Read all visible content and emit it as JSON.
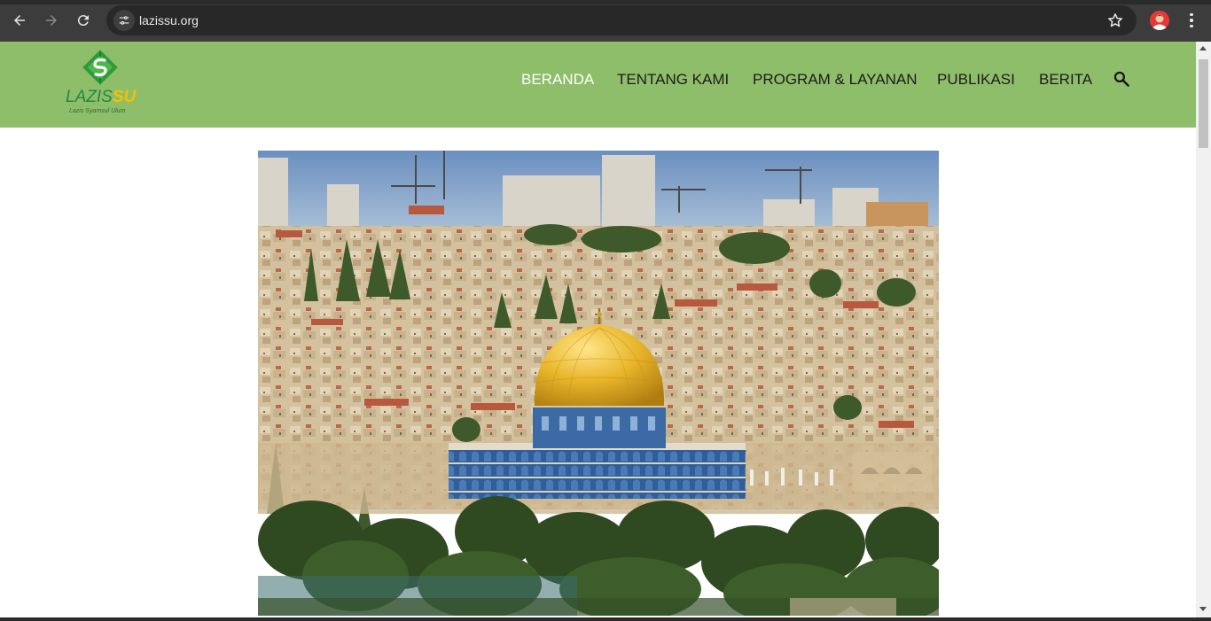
{
  "browser": {
    "url": "lazissu.org",
    "back_icon": "arrow-left-icon",
    "forward_icon": "arrow-right-icon",
    "reload_icon": "reload-icon",
    "site_info_icon": "tune-icon",
    "bookmark_icon": "star-icon",
    "menu_icon": "kebab-icon"
  },
  "site": {
    "logo": {
      "name_part1": "LAZIS",
      "name_part2": "SU",
      "tagline": "Lazis Syamsul Ulum"
    },
    "menu": [
      {
        "label": "BERANDA",
        "active": true
      },
      {
        "label": "TENTANG KAMI",
        "active": false
      },
      {
        "label": "PROGRAM & LAYANAN",
        "active": false
      },
      {
        "label": "PUBLIKASI",
        "active": false
      },
      {
        "label": "BERITA",
        "active": false
      }
    ],
    "search_icon": "search-icon",
    "colors": {
      "header_bg": "#8fbe6b",
      "menu_active": "#ffffff",
      "menu_text": "#1b1b1b",
      "logo_green": "#1f8a3a",
      "logo_yellow": "#f2c200"
    }
  },
  "hero": {
    "image": "dome-of-the-rock-jerusalem-photo"
  }
}
